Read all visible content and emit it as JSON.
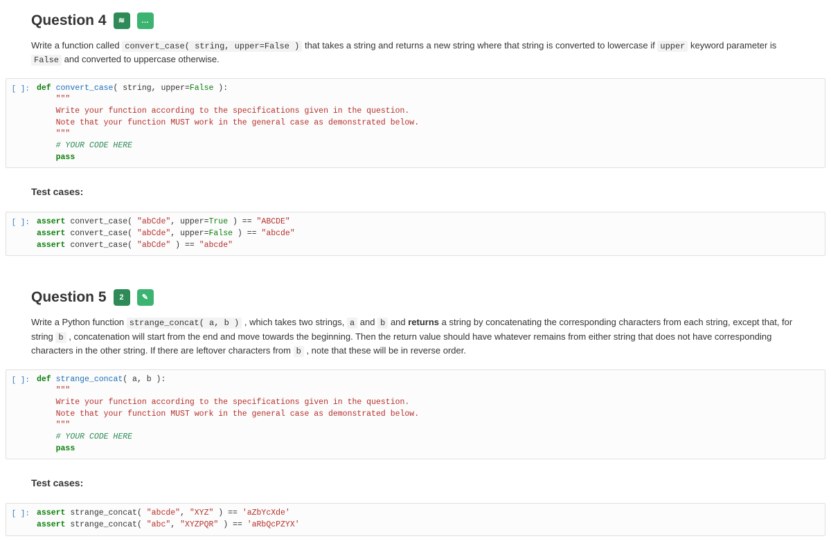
{
  "q4": {
    "title": "Question 4",
    "badge1": "≋",
    "badge2": "…",
    "desc_pre": "Write a function called ",
    "sig": "convert_case( string, upper=False )",
    "desc_mid1": " that takes a string and returns a new string where that string is converted to lowercase if ",
    "kw_upper": "upper",
    "desc_mid2": " keyword parameter is ",
    "kw_false": "False",
    "desc_post": " and converted to uppercase otherwise.",
    "prompt": "[ ]:",
    "code": {
      "def_kw": "def",
      "fn": "convert_case",
      "params_open": "( string, upper=",
      "false_lit": "False",
      "params_close": " ):",
      "docq": "\"\"\"",
      "doc1": "Write your function according to the specifications given in the question.",
      "doc2": "Note that your function MUST work in the general case as demonstrated below.",
      "your": "# YOUR CODE HERE",
      "pass_kw": "pass"
    },
    "tests_heading": "Test cases:",
    "tests": {
      "a_kw": "assert",
      "l1_call": " convert_case( ",
      "l1_arg": "\"abCde\"",
      "l1_mid": ", upper=",
      "l1_bool": "True",
      "l1_eq": " ) == ",
      "l1_exp": "\"ABCDE\"",
      "l2_bool": "False",
      "l2_exp": "\"abcde\"",
      "l3_call": " convert_case( ",
      "l3_arg": "\"abCde\"",
      "l3_eq": " ) == ",
      "l3_exp": "\"abcde\""
    }
  },
  "q5": {
    "title": "Question 5",
    "badge1": "2",
    "badge2": "✎",
    "desc_pre": "Write a Python function ",
    "sig": "strange_concat( a, b )",
    "desc_mid1": " , which takes two strings, ",
    "a": "a",
    "and1": " and ",
    "b": "b",
    "and2": " and ",
    "returns": "returns",
    "desc_mid2": " a string by concatenating the corresponding characters from each string, except that, for string ",
    "desc_mid3": " , concatenation will start from the end and move towards the beginning. Then the return value should have whatever remains from either string that does not have corresponding characters in the other string. If there are leftover characters from ",
    "desc_post": " , note that these will be in reverse order.",
    "prompt": "[ ]:",
    "code": {
      "def_kw": "def",
      "fn": "strange_concat",
      "params": "( a, b ):",
      "docq": "\"\"\"",
      "doc1": "Write your function according to the specifications given in the question.",
      "doc2": "Note that your function MUST work in the general case as demonstrated below.",
      "your": "# YOUR CODE HERE",
      "pass_kw": "pass"
    },
    "tests_heading": "Test cases:",
    "tests": {
      "a_kw": "assert",
      "l1_call": " strange_concat( ",
      "l1_a1": "\"abcde\"",
      "l1_sep": ", ",
      "l1_a2": "\"XYZ\"",
      "l1_eq": " ) == ",
      "l1_exp": "'aZbYcXde'",
      "l2_a1": "\"abc\"",
      "l2_a2": "\"XYZPQR\"",
      "l2_exp": "'aRbQcPZYX'"
    }
  }
}
